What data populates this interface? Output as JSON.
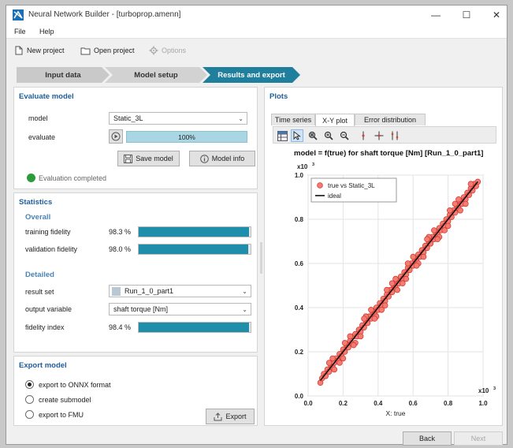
{
  "window": {
    "title": "Neural Network Builder - [turboprop.amenn]"
  },
  "menu": {
    "file": "File",
    "help": "Help"
  },
  "toolbar": {
    "new_project": "New project",
    "open_project": "Open project",
    "options": "Options"
  },
  "steps": [
    {
      "label": "Input data"
    },
    {
      "label": "Model setup"
    },
    {
      "label": "Results and export"
    }
  ],
  "evaluate": {
    "title": "Evaluate model",
    "model_label": "model",
    "model_value": "Static_3L",
    "evaluate_label": "evaluate",
    "progress_text": "100%",
    "progress_value": 1.0,
    "save_model": "Save model",
    "model_info": "Model info",
    "status": "Evaluation completed"
  },
  "statistics": {
    "title": "Statistics",
    "overall_title": "Overall",
    "training_label": "training fidelity",
    "training_value": "98.3 %",
    "training_fraction": 0.983,
    "validation_label": "validation fidelity",
    "validation_value": "98.0 %",
    "validation_fraction": 0.98,
    "detailed_title": "Detailed",
    "result_set_label": "result set",
    "result_set_value": "Run_1_0_part1",
    "output_var_label": "output variable",
    "output_var_value": "shaft torque [Nm]",
    "fidelity_label": "fidelity index",
    "fidelity_value": "98.4 %",
    "fidelity_fraction": 0.984
  },
  "export": {
    "title": "Export model",
    "opt_onnx": "export to ONNX format",
    "opt_submodel": "create submodel",
    "opt_fmu": "export to FMU",
    "export_button": "Export"
  },
  "plots": {
    "title": "Plots",
    "tabs": [
      "Time series",
      "X-Y plot",
      "Error distribution"
    ]
  },
  "footer": {
    "back": "Back",
    "next": "Next"
  },
  "colors": {
    "accent": "#1f8eaa",
    "title_blue": "#1d5f9e",
    "status_green": "#2e9b3a",
    "points": "#f05b52"
  },
  "chart_data": {
    "type": "scatter",
    "title": "model = f(true) for shaft torque [Nm] [Run_1_0_part1]",
    "xlabel": "X: true",
    "x_exponent": "x10",
    "y_exponent": "x10",
    "xlim": [
      0.0,
      1.0
    ],
    "ylim": [
      0.0,
      1.0
    ],
    "xticks": [
      "0.0",
      "0.2",
      "0.4",
      "0.6",
      "0.8",
      "1.0"
    ],
    "yticks": [
      "0.0",
      "0.2",
      "0.4",
      "0.6",
      "0.8",
      "1.0"
    ],
    "grid": true,
    "legend_position": "top-left",
    "series": [
      {
        "name": "true vs Static_3L",
        "kind": "points",
        "x": [
          0.07,
          0.08,
          0.09,
          0.1,
          0.11,
          0.12,
          0.13,
          0.14,
          0.15,
          0.16,
          0.17,
          0.18,
          0.19,
          0.2,
          0.21,
          0.22,
          0.23,
          0.24,
          0.25,
          0.26,
          0.27,
          0.28,
          0.29,
          0.3,
          0.31,
          0.32,
          0.33,
          0.34,
          0.35,
          0.36,
          0.37,
          0.38,
          0.39,
          0.4,
          0.41,
          0.42,
          0.43,
          0.44,
          0.45,
          0.46,
          0.47,
          0.48,
          0.49,
          0.5,
          0.51,
          0.52,
          0.53,
          0.54,
          0.55,
          0.56,
          0.57,
          0.58,
          0.59,
          0.6,
          0.61,
          0.62,
          0.63,
          0.64,
          0.65,
          0.66,
          0.67,
          0.68,
          0.69,
          0.7,
          0.71,
          0.72,
          0.73,
          0.74,
          0.75,
          0.76,
          0.77,
          0.78,
          0.79,
          0.8,
          0.81,
          0.82,
          0.83,
          0.84,
          0.85,
          0.86,
          0.87,
          0.88,
          0.89,
          0.9,
          0.91,
          0.92,
          0.93,
          0.94,
          0.95,
          0.96,
          0.97,
          0.12,
          0.18,
          0.24,
          0.3,
          0.36,
          0.42,
          0.48,
          0.54,
          0.6,
          0.66,
          0.72,
          0.78,
          0.84,
          0.9,
          0.15,
          0.21,
          0.27,
          0.33,
          0.39,
          0.45,
          0.51,
          0.57,
          0.63,
          0.69,
          0.75,
          0.81,
          0.87,
          0.93,
          0.14,
          0.2,
          0.26,
          0.32,
          0.38,
          0.44,
          0.5,
          0.56,
          0.62,
          0.68,
          0.74,
          0.8,
          0.86
        ],
        "y": [
          0.06,
          0.08,
          0.1,
          0.09,
          0.12,
          0.11,
          0.14,
          0.13,
          0.15,
          0.17,
          0.16,
          0.19,
          0.18,
          0.21,
          0.2,
          0.23,
          0.22,
          0.25,
          0.24,
          0.27,
          0.28,
          0.27,
          0.3,
          0.29,
          0.32,
          0.31,
          0.34,
          0.33,
          0.36,
          0.35,
          0.38,
          0.37,
          0.4,
          0.39,
          0.42,
          0.41,
          0.44,
          0.43,
          0.46,
          0.45,
          0.48,
          0.47,
          0.5,
          0.49,
          0.52,
          0.51,
          0.54,
          0.53,
          0.56,
          0.55,
          0.58,
          0.57,
          0.6,
          0.59,
          0.62,
          0.61,
          0.64,
          0.63,
          0.66,
          0.65,
          0.68,
          0.67,
          0.7,
          0.69,
          0.72,
          0.71,
          0.74,
          0.73,
          0.76,
          0.75,
          0.78,
          0.77,
          0.8,
          0.79,
          0.82,
          0.81,
          0.84,
          0.83,
          0.86,
          0.85,
          0.88,
          0.87,
          0.9,
          0.89,
          0.92,
          0.91,
          0.94,
          0.93,
          0.96,
          0.95,
          0.97,
          0.15,
          0.15,
          0.27,
          0.27,
          0.39,
          0.39,
          0.51,
          0.51,
          0.63,
          0.63,
          0.75,
          0.75,
          0.87,
          0.87,
          0.12,
          0.24,
          0.24,
          0.36,
          0.36,
          0.48,
          0.48,
          0.6,
          0.6,
          0.72,
          0.72,
          0.84,
          0.84,
          0.96,
          0.17,
          0.17,
          0.23,
          0.35,
          0.35,
          0.41,
          0.53,
          0.53,
          0.59,
          0.71,
          0.71,
          0.77,
          0.89
        ]
      },
      {
        "name": "ideal",
        "kind": "line",
        "x": [
          0.07,
          0.97
        ],
        "y": [
          0.07,
          0.97
        ]
      }
    ]
  }
}
